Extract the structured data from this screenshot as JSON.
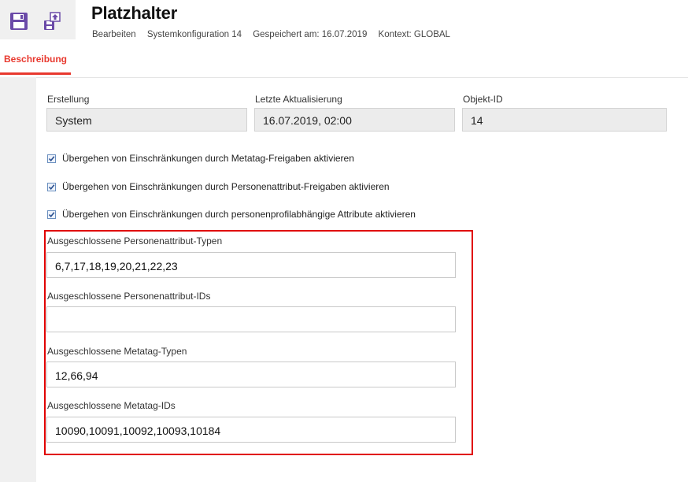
{
  "toolbar": {
    "save_icon": "floppy-disk-icon",
    "export_icon": "export-upload-icon",
    "icon_color": "#6b4aa8"
  },
  "header": {
    "title": "Platzhalter",
    "meta": [
      "Bearbeiten",
      "Systemkonfiguration 14",
      "Gespeichert am: 16.07.2019",
      "Kontext: GLOBAL"
    ]
  },
  "tabs": [
    {
      "label": "Beschreibung",
      "active": true
    }
  ],
  "info": {
    "creation_label": "Erstellung",
    "creation_value": "System",
    "updated_label": "Letzte Aktualisierung",
    "updated_value": "16.07.2019, 02:00",
    "objid_label": "Objekt-ID",
    "objid_value": "14"
  },
  "checkboxes": [
    {
      "label": "Übergehen von Einschränkungen durch Metatag-Freigaben aktivieren",
      "checked": true
    },
    {
      "label": "Übergehen von Einschränkungen durch Personenattribut-Freigaben aktivieren",
      "checked": true
    },
    {
      "label": "Übergehen von Einschränkungen durch personenprofilabhängige Attribute aktivieren",
      "checked": true
    }
  ],
  "fields": [
    {
      "label": "Ausgeschlossene Personenattribut-Typen",
      "value": "6,7,17,18,19,20,21,22,23"
    },
    {
      "label": "Ausgeschlossene Personenattribut-IDs",
      "value": ""
    },
    {
      "label": "Ausgeschlossene Metatag-Typen",
      "value": "12,66,94"
    },
    {
      "label": "Ausgeschlossene Metatag-IDs",
      "value": "10090,10091,10092,10093,10184"
    }
  ],
  "colors": {
    "accent": "#e8392f",
    "highlight_frame": "#e00000",
    "checkbox_check": "#2a4f8f"
  }
}
